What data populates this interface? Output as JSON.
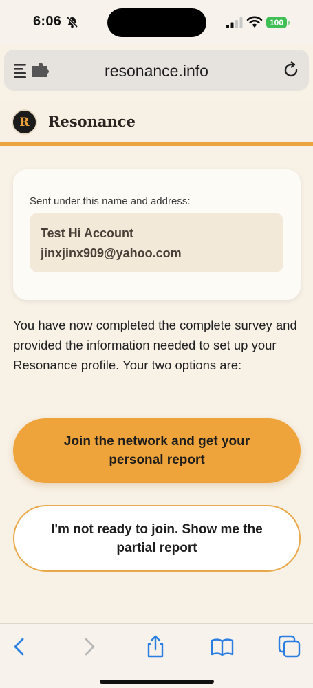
{
  "status_bar": {
    "time": "6:06",
    "battery": "100"
  },
  "browser": {
    "url": "resonance.info"
  },
  "site": {
    "logo_letter": "R",
    "brand": "Resonance"
  },
  "sender": {
    "label": "Sent under this name and address:",
    "name": "Test Hi Account",
    "email": "jinxjinx909@yahoo.com"
  },
  "intro": "You have now completed the complete survey and provided the information needed to set up your Resonance profile. Your two options are:",
  "buttons": {
    "join": "Join the network and get your personal report",
    "partial": "I'm not ready to join. Show me the partial report"
  },
  "toolbar_icons": [
    "back-icon",
    "forward-icon",
    "share-icon",
    "bookmarks-icon",
    "tabs-icon"
  ],
  "colors": {
    "accent": "#efa43b",
    "background": "#f7f1e6",
    "battery": "#3fbf54",
    "ios_blue": "#2a7de1"
  }
}
